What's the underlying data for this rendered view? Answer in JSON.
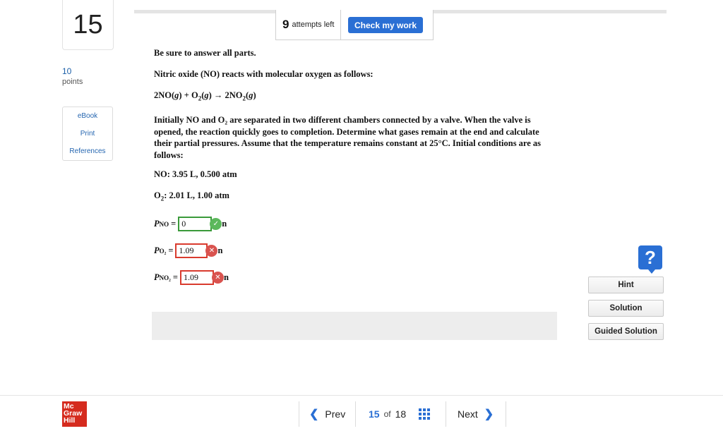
{
  "question": {
    "number": "15",
    "points_value": "10",
    "points_label": "points"
  },
  "side_links": [
    "eBook",
    "Print",
    "References"
  ],
  "attempts": {
    "count": "9",
    "label": "attempts left",
    "check_button": "Check my work"
  },
  "body": {
    "instruction": "Be sure to answer all parts.",
    "intro": "Nitric oxide (NO) reacts with molecular oxygen as follows:",
    "paragraph": "Initially NO and O₂ are separated in two different chambers connected by a valve. When the valve is opened, the reaction quickly goes to completion. Determine what gases remain at the end and calculate their partial pressures. Assume that the temperature remains constant at 25°C. Initial conditions are as follows:",
    "cond_no": "NO: 3.95 L, 0.500 atm",
    "cond_o2_value": ": 2.01 L, 1.00 atm"
  },
  "answers": [
    {
      "label_main": "P",
      "label_sub": "NO",
      "value": "0",
      "status": "correct",
      "unit": "n"
    },
    {
      "label_main": "P",
      "label_sub": "O₂",
      "value": "1.09",
      "status": "incorrect",
      "unit": "n"
    },
    {
      "label_main": "P",
      "label_sub": "NO₂",
      "value": "1.09",
      "status": "incorrect",
      "unit": "n"
    }
  ],
  "help": {
    "icon": "?",
    "buttons": [
      "Hint",
      "Solution",
      "Guided Solution"
    ]
  },
  "footer": {
    "logo_lines": [
      "Mc",
      "Graw",
      "Hill"
    ],
    "prev": "Prev",
    "current": "15",
    "of": "of",
    "total": "18",
    "next": "Next"
  },
  "colors": {
    "accent": "#2a6fd4",
    "correct": "#5cb85c",
    "incorrect": "#d9534f",
    "logo": "#d52b1e"
  }
}
